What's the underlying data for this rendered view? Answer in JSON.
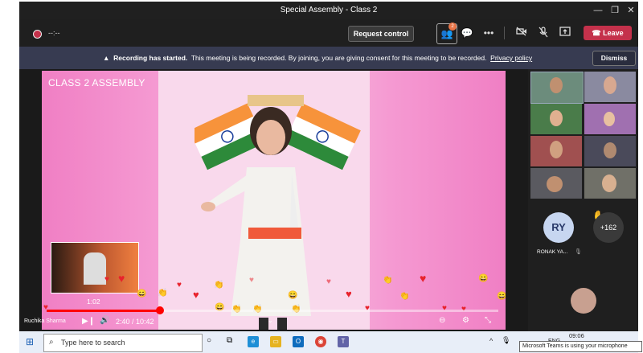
{
  "window": {
    "title": "Special Assembly - Class 2"
  },
  "meeting_bar": {
    "recording_timer": "--:--",
    "request_control_label": "Request control",
    "participants_badge": "2",
    "leave_label": "Leave"
  },
  "notice": {
    "bold": "Recording has started.",
    "text": "This meeting is being recorded. By joining, you are giving consent for this meeting to be recorded.",
    "link": "Privacy policy",
    "dismiss_label": "Dismiss"
  },
  "video": {
    "title": "CLASS 2 ASSEMBLY",
    "preview_time": "1:02",
    "time_current": "2:40",
    "time_total": "10:42",
    "time_display": "2:40 / 10:42",
    "progress": 0.25,
    "presenter_name": "Ruchika Sharma"
  },
  "gallery": {
    "initials": "RY",
    "name_label": "RONAK YA...",
    "overflow_count": "+162"
  },
  "taskbar": {
    "search_placeholder": "Type here to search",
    "clock": "09:06",
    "lang": "ENG",
    "toast": "Microsoft Teams is using your microphone"
  },
  "colors": {
    "leave": "#c4314b",
    "notice_bg": "#373b51",
    "progress": "#ff0000",
    "accent": "#6264a7"
  }
}
